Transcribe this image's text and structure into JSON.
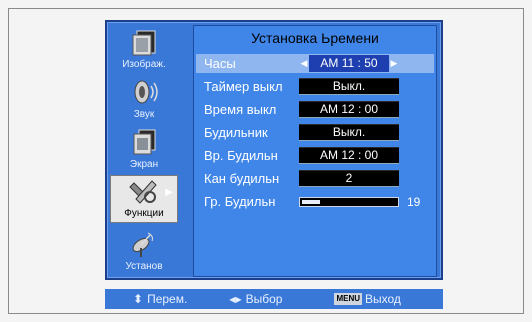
{
  "sidebar": {
    "items": [
      {
        "label": "Изображ.",
        "icon": "picture-icon"
      },
      {
        "label": "Звук",
        "icon": "sound-icon"
      },
      {
        "label": "Экран",
        "icon": "screen-icon"
      },
      {
        "label": "Функции",
        "icon": "functions-icon",
        "active": true
      },
      {
        "label": "Установ",
        "icon": "setup-icon"
      }
    ],
    "active_arrow": "▶"
  },
  "panel": {
    "title": "Установка Ьремени",
    "rows": [
      {
        "label": "Часы",
        "value": "AM 11 : 50",
        "left_arrow": "◀",
        "right_arrow": "▶"
      },
      {
        "label": "Таймер выкл",
        "value": "Выкл."
      },
      {
        "label": "Время выкл",
        "value": "AM 12 : 00"
      },
      {
        "label": "Будильник",
        "value": "Выкл."
      },
      {
        "label": "Вр. Будильн",
        "value": "AM 12 : 00"
      },
      {
        "label": "Кан будильн",
        "value": "2"
      },
      {
        "label": "Гр. Будильн",
        "value": "19",
        "level": 19
      }
    ]
  },
  "bottom": {
    "move_icon": "⬍",
    "move_label": "Перем.",
    "select_icon": "◀▶",
    "select_label": "Выбор",
    "menu_key": "MENU",
    "exit_label": "Выход"
  },
  "colors": {
    "osd_background": "#3a78d8",
    "panel_background": "#3f86e8",
    "selected_row": "#8fb6ee",
    "value_box": "#000000"
  }
}
